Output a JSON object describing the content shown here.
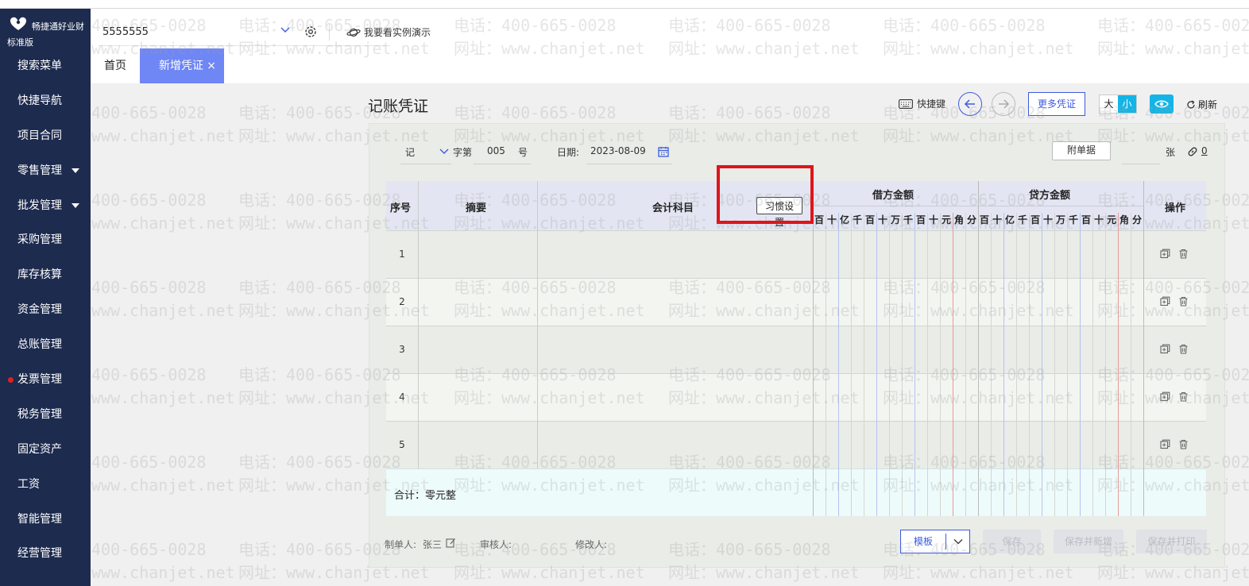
{
  "app": {
    "name": "畅捷通好业财",
    "edition": "标准版"
  },
  "sidebar": {
    "items": [
      {
        "label": "搜索菜单"
      },
      {
        "label": "快捷导航"
      },
      {
        "label": "项目合同"
      },
      {
        "label": "零售管理"
      },
      {
        "label": "批发管理"
      },
      {
        "label": "采购管理"
      },
      {
        "label": "库存核算"
      },
      {
        "label": "资金管理"
      },
      {
        "label": "总账管理"
      },
      {
        "label": "发票管理"
      },
      {
        "label": "税务管理"
      },
      {
        "label": "固定资产"
      },
      {
        "label": "工资"
      },
      {
        "label": "智能管理"
      },
      {
        "label": "经营管理"
      }
    ]
  },
  "header": {
    "account": "5555555",
    "demo_label": "我要看实例演示"
  },
  "tabs": {
    "home": "首页",
    "active": "新增凭证",
    "close": "×"
  },
  "voucher": {
    "title": "记账凭证",
    "shortcut_label": "快捷键",
    "more_label": "更多凭证",
    "size_large": "大",
    "size_small": "小",
    "refresh_label": "刷新",
    "word": "记",
    "word_suffix": "字第",
    "number": "005",
    "number_suffix": "号",
    "date_label": "日期:",
    "date": "2023-08-09",
    "attach_label": "附单据",
    "attach_unit": "张",
    "attach_count": "0"
  },
  "table": {
    "col_seq": "序号",
    "col_summary": "摘要",
    "col_account": "会计科目",
    "habit_button": "习惯设置",
    "col_debit": "借方金额",
    "col_credit": "贷方金额",
    "col_ops": "操作",
    "digit_units": [
      "百",
      "十",
      "亿",
      "千",
      "百",
      "十",
      "万",
      "千",
      "百",
      "十",
      "元",
      "角",
      "分"
    ],
    "rows": [
      "1",
      "2",
      "3",
      "4",
      "5"
    ],
    "total_label": "合计：零元整"
  },
  "footer": {
    "maker_label": "制单人:",
    "maker": "张三",
    "reviewer_label": "审核人:",
    "modifier_label": "修改人:",
    "template_label": "模板",
    "save_label": "保存",
    "save_new_label": "保存并新增",
    "save_print_label": "保存并打印"
  },
  "watermark": {
    "phone": "电话：400-665-0028",
    "web": "网址：www.chanjet.net",
    "phone_partial": "400-665-0028",
    "web_partial": "www.chanjet.net"
  },
  "colors": {
    "sidebar_bg": "#1d2b4f",
    "tab_active": "#6f86f5",
    "accent": "#3d5ae0",
    "toggle_on": "#14b5e6",
    "highlight_box": "#e0141a"
  }
}
